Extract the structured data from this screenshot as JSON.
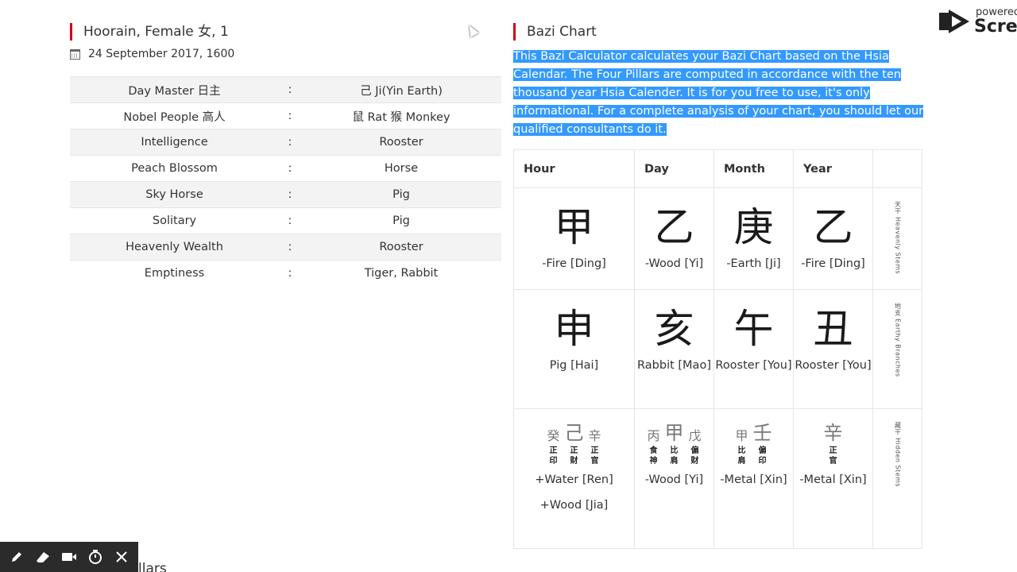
{
  "profile": {
    "title": "Hoorain, Female 女, 1",
    "birth": "24 September 2017, 1600",
    "attributes": [
      {
        "label": "Day Master 日主",
        "sep": ":",
        "value": "己 Ji(Yin Earth)"
      },
      {
        "label": "Nobel People 高人",
        "sep": ":",
        "value": "鼠 Rat 猴 Monkey"
      },
      {
        "label": "Intelligence",
        "sep": ":",
        "value": "Rooster"
      },
      {
        "label": "Peach Blossom",
        "sep": ":",
        "value": "Horse"
      },
      {
        "label": "Sky Horse",
        "sep": ":",
        "value": "Pig"
      },
      {
        "label": "Solitary",
        "sep": ":",
        "value": "Pig"
      },
      {
        "label": "Heavenly Wealth",
        "sep": ":",
        "value": "Rooster"
      },
      {
        "label": "Emptiness",
        "sep": ":",
        "value": "Tiger, Rabbit"
      }
    ]
  },
  "bazi": {
    "title": "Bazi Chart",
    "description": "This Bazi Calculator calculates your Bazi Chart based on the Hsia Calendar. The Four Pillars are computed in accordance with the ten thousand year Hsia Calender. It is for you free to use, it's only informational. For a complete analysis of your chart, you should let our qualified consultants do it.",
    "headers": [
      "Hour",
      "Day",
      "Month",
      "Year"
    ],
    "row_labels": {
      "stems": "天干 Heavenly Stems",
      "branches": "地支 Earthy Branches",
      "hidden": "藏干 Hidden Stems"
    },
    "stems": [
      {
        "char": "甲",
        "text": "-Fire [Ding]"
      },
      {
        "char": "乙",
        "text": "-Wood [Yi]"
      },
      {
        "char": "庚",
        "text": "-Earth [Ji]"
      },
      {
        "char": "乙",
        "text": "-Fire [Ding]"
      }
    ],
    "branches": [
      {
        "char": "申",
        "text": "Pig [Hai]"
      },
      {
        "char": "亥",
        "text": "Rabbit [Mao]"
      },
      {
        "char": "午",
        "text": "Rooster [You]"
      },
      {
        "char": "丑",
        "text": "Rooster [You]"
      }
    ],
    "hidden": [
      {
        "stems": [
          {
            "ch": "癸",
            "gods": "正印"
          },
          {
            "ch": "己",
            "gods": "正财",
            "big": true
          },
          {
            "ch": "辛",
            "gods": "正官"
          }
        ],
        "lines": [
          "+Water [Ren]",
          "+Wood [Jia]"
        ]
      },
      {
        "stems": [
          {
            "ch": "丙",
            "gods": "食神"
          },
          {
            "ch": "甲",
            "gods": "比肩",
            "big": true
          },
          {
            "ch": "戊",
            "gods": "偏财"
          }
        ],
        "lines": [
          "-Wood [Yi]"
        ]
      },
      {
        "stems": [
          {
            "ch": "甲",
            "gods": "比肩"
          },
          {
            "ch": "壬",
            "gods": "偏印",
            "big": true
          }
        ],
        "lines": [
          "-Metal [Xin]"
        ]
      },
      {
        "stems": [
          {
            "ch": "辛",
            "gods": "正官",
            "big": true
          }
        ],
        "lines": [
          "-Metal [Xin]"
        ]
      }
    ]
  },
  "branding": {
    "powered": "powered",
    "name": "Scree"
  },
  "toolbar": {
    "items": [
      "pencil-icon",
      "eraser-icon",
      "camera-icon",
      "timer-icon",
      "close-icon"
    ]
  },
  "cut_heading": "llars"
}
